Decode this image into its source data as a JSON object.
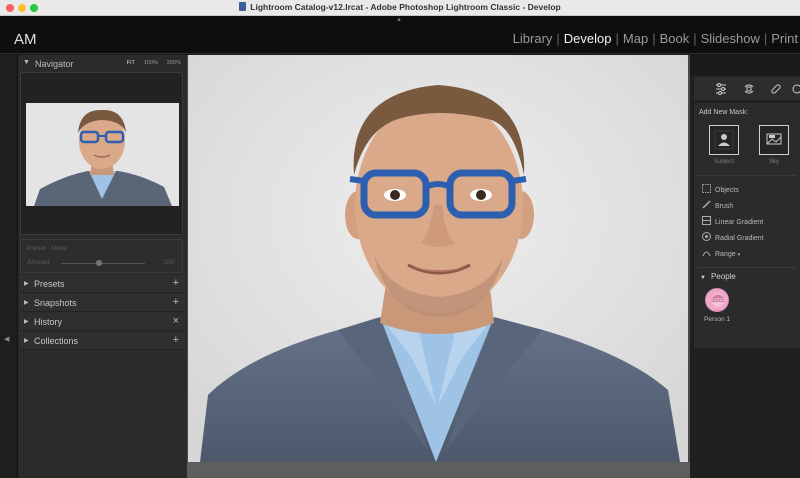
{
  "window": {
    "title": "Lightroom Catalog-v12.lrcat - Adobe Photoshop Lightroom Classic - Develop"
  },
  "identity_plate": "AM",
  "modules": [
    {
      "label": "Library",
      "active": false
    },
    {
      "label": "Develop",
      "active": true
    },
    {
      "label": "Map",
      "active": false
    },
    {
      "label": "Book",
      "active": false
    },
    {
      "label": "Slideshow",
      "active": false
    },
    {
      "label": "Print",
      "active": false
    }
  ],
  "module_separator": "|",
  "navigator": {
    "title": "Navigator",
    "zoom_options": [
      "FIT",
      "100%",
      "200%"
    ]
  },
  "preset_box": {
    "preset_name": "Preset : None",
    "amount_label": "Amount",
    "amount_value": "100",
    "amount_fraction": 0.45
  },
  "left_sections": [
    {
      "label": "Presets",
      "action": "+"
    },
    {
      "label": "Snapshots",
      "action": "+"
    },
    {
      "label": "History",
      "action": "×"
    },
    {
      "label": "Collections",
      "action": "+"
    }
  ],
  "masking": {
    "add_new_mask": "Add New Mask:",
    "subject": "Subject",
    "sky": "Sky",
    "tools": [
      "Objects",
      "Brush",
      "Linear Gradient",
      "Radial Gradient",
      "Range"
    ],
    "range_suffix": "▾"
  },
  "people": {
    "title": "People",
    "persons": [
      {
        "name": "Person 1"
      }
    ]
  },
  "colors": {
    "glasses": "#2c5fb0",
    "jacket": "#5a6678",
    "shirt": "#9fc3e4",
    "skin": "#d9a98a",
    "avatar": "#f2a7c8"
  }
}
